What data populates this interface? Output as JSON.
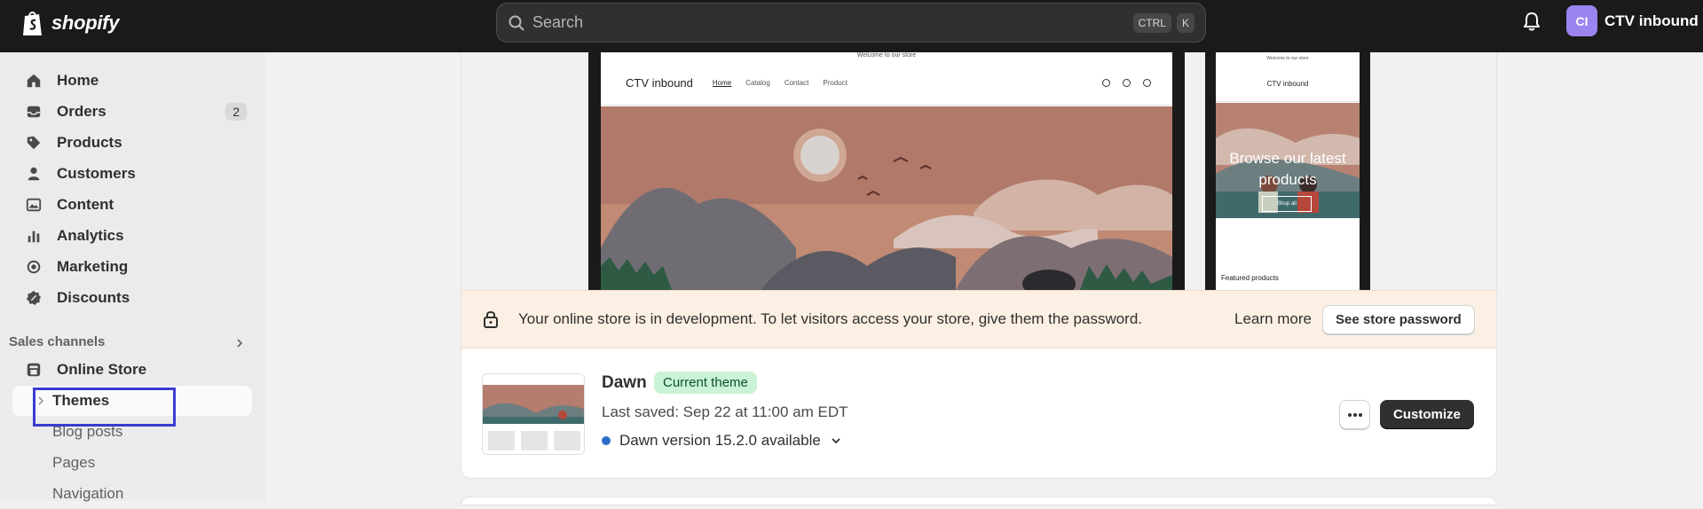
{
  "topbar": {
    "logo_text": "shopify",
    "search_placeholder": "Search",
    "shortcut_keys": [
      "CTRL",
      "K"
    ],
    "account_initials": "CI",
    "account_name": "CTV inbound"
  },
  "sidebar": {
    "items": [
      {
        "label": "Home",
        "icon": "home-icon"
      },
      {
        "label": "Orders",
        "icon": "orders-icon",
        "badge": "2"
      },
      {
        "label": "Products",
        "icon": "tag-icon"
      },
      {
        "label": "Customers",
        "icon": "person-icon"
      },
      {
        "label": "Content",
        "icon": "image-icon"
      },
      {
        "label": "Analytics",
        "icon": "bar-chart-icon"
      },
      {
        "label": "Marketing",
        "icon": "target-icon"
      },
      {
        "label": "Discounts",
        "icon": "discount-icon"
      }
    ],
    "sales_channels_label": "Sales channels",
    "online_store_label": "Online Store",
    "sub_items": [
      {
        "label": "Themes"
      },
      {
        "label": "Blog posts"
      },
      {
        "label": "Pages"
      },
      {
        "label": "Navigation"
      }
    ]
  },
  "preview": {
    "announcement": "Welcome to our store",
    "store_name": "CTV inbound",
    "nav_links": [
      "Home",
      "Catalog",
      "Contact",
      "Product"
    ],
    "mobile_hero_text": "Browse our latest products",
    "mobile_shop_button": "Shop all",
    "mobile_featured": "Featured products"
  },
  "banner": {
    "message": "Your online store is in development. To let visitors access your store, give them the password.",
    "learn_more": "Learn more",
    "button": "See store password"
  },
  "theme": {
    "name": "Dawn",
    "badge": "Current theme",
    "last_saved": "Last saved: Sep 22 at 11:00 am EDT",
    "version": "Dawn version 15.2.0 available",
    "customize_button": "Customize"
  },
  "colors": {
    "topbar": "#1a1a1a",
    "accent_highlight": "#3b3bd1",
    "badge_green": "#c9f3d4",
    "banner_bg": "#fcefe3",
    "primary_button": "#303030"
  }
}
